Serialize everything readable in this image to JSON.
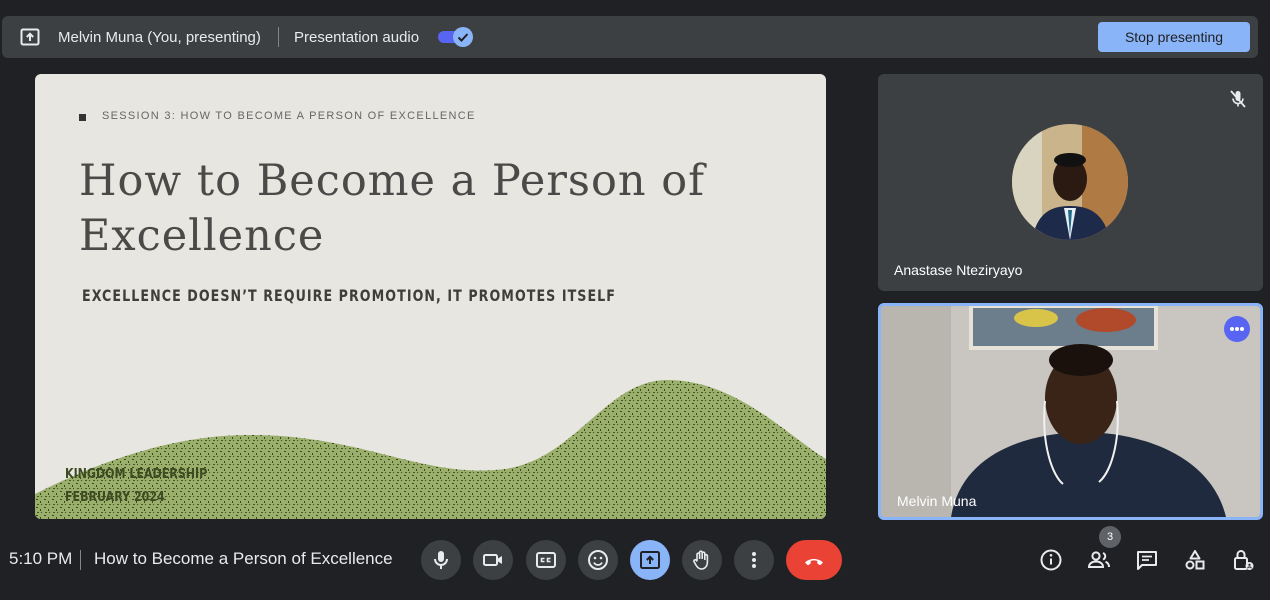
{
  "topbar": {
    "presenter": "Melvin Muna (You, presenting)",
    "audio_label": "Presentation audio",
    "audio_enabled": true,
    "stop_label": "Stop presenting"
  },
  "slide": {
    "session": "SESSION 3: HOW TO BECOME A PERSON OF EXCELLENCE",
    "title": "How to Become a Person of Excellence",
    "subtitle": "EXCELLENCE DOESN’T REQUIRE PROMOTION, IT PROMOTES ITSELF",
    "footer_line1": "KINGDOM LEADERSHIP",
    "footer_line2": "FEBRUARY 2024",
    "hill_color": "#9aaf6b"
  },
  "participants": [
    {
      "name": "Anastase Nteziryayo",
      "muted": true
    },
    {
      "name": "Melvin Muna",
      "speaking": true
    }
  ],
  "bottom": {
    "time": "5:10 PM",
    "meeting_title": "How to Become a Person of Excellence",
    "participant_count": "3"
  },
  "colors": {
    "accent": "#8ab4f8",
    "end_call": "#ea4335",
    "background": "#202124",
    "surface": "#3c4043"
  }
}
